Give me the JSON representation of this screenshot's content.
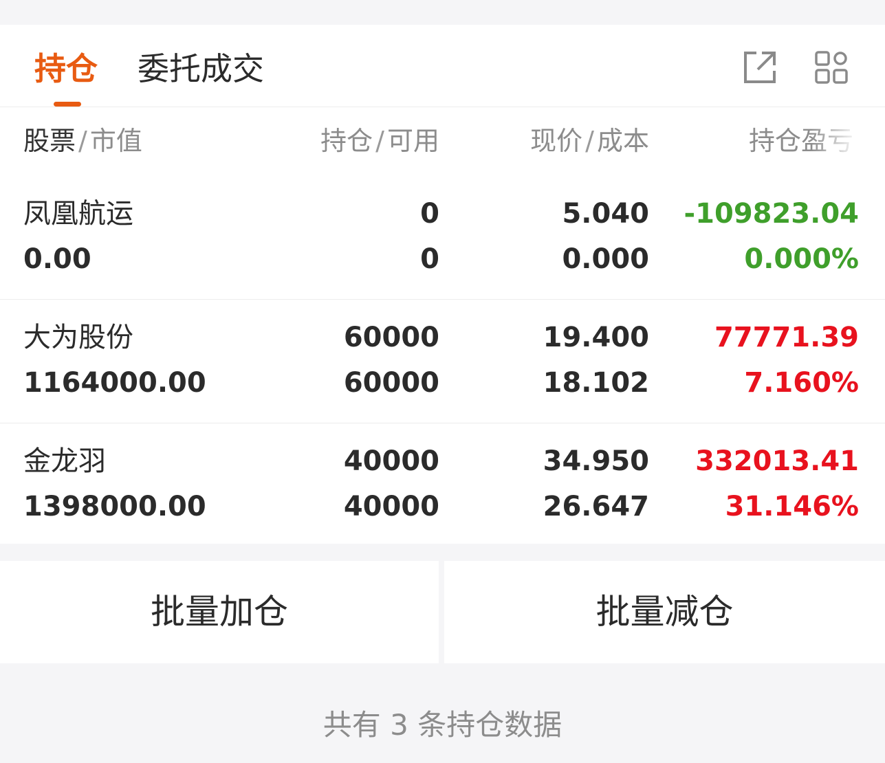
{
  "tabs": {
    "positions": "持仓",
    "orders": "委托成交"
  },
  "columns": {
    "stock": "股票",
    "market_value": "市值",
    "holdings": "持仓",
    "available": "可用",
    "price": "现价",
    "cost": "成本",
    "pnl": "持仓盈亏",
    "sep": "/"
  },
  "rows": [
    {
      "name": "凤凰航运",
      "market_value": "0.00",
      "holdings": "0",
      "available": "0",
      "price": "5.040",
      "cost": "0.000",
      "pnl": "-109823.04",
      "pnl_pct": "0.000%",
      "trend": "loss"
    },
    {
      "name": "大为股份",
      "market_value": "1164000.00",
      "holdings": "60000",
      "available": "60000",
      "price": "19.400",
      "cost": "18.102",
      "pnl": "77771.39",
      "pnl_pct": "7.160%",
      "trend": "gain"
    },
    {
      "name": "金龙羽",
      "market_value": "1398000.00",
      "holdings": "40000",
      "available": "40000",
      "price": "34.950",
      "cost": "26.647",
      "pnl": "332013.41",
      "pnl_pct": "31.146%",
      "trend": "gain"
    }
  ],
  "actions": {
    "batch_add": "批量加仓",
    "batch_reduce": "批量减仓"
  },
  "footer": "共有 3 条持仓数据",
  "colors": {
    "accent": "#e85b12",
    "gain": "#e8121e",
    "loss": "#3f9f2b"
  },
  "icons": {
    "share": "share-icon",
    "grid": "grid-icon"
  }
}
